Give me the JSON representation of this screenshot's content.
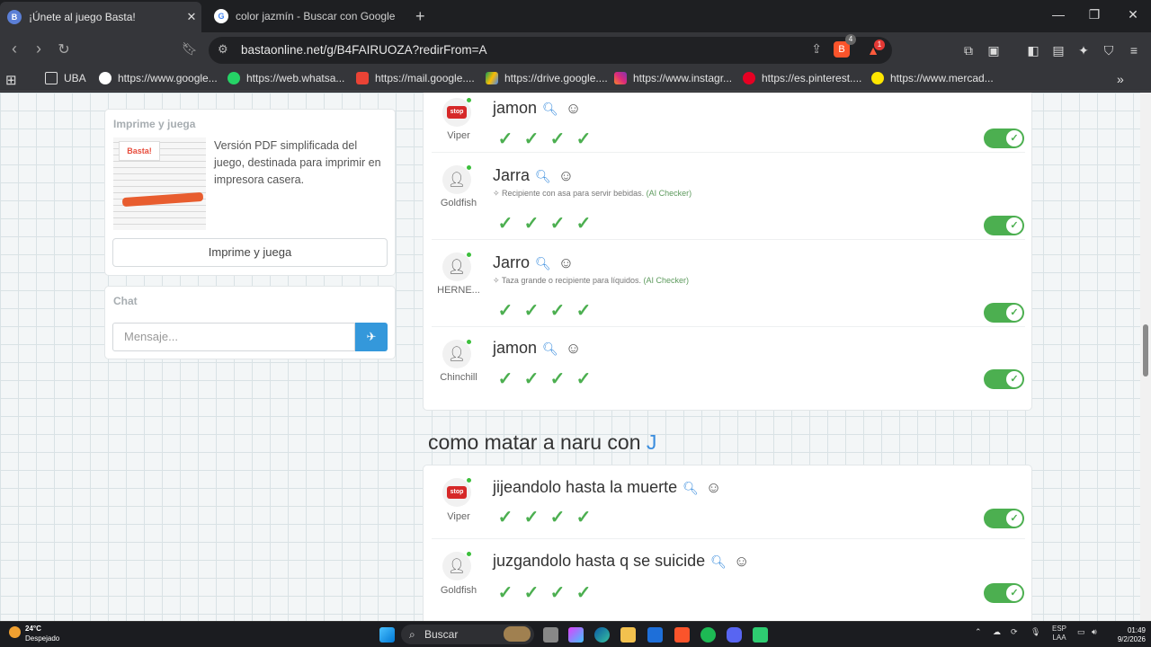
{
  "browser": {
    "tabs": [
      {
        "title": "¡Únete al juego Basta!",
        "active": true
      },
      {
        "title": "color jazmín - Buscar con Google",
        "active": false
      }
    ],
    "url": "bastaonline.net/g/B4FAIRUOZA?redirFrom=A",
    "extension_badges": {
      "brave": "4",
      "rewards": "1"
    },
    "bookmarks": [
      {
        "label": "UBA",
        "icon": "folder-icon"
      },
      {
        "label": "https://www.google...",
        "icon": "google-icon"
      },
      {
        "label": "https://web.whatsa...",
        "icon": "whatsapp-icon"
      },
      {
        "label": "https://mail.google....",
        "icon": "gmail-icon"
      },
      {
        "label": "https://drive.google....",
        "icon": "drive-icon"
      },
      {
        "label": "https://www.instagr...",
        "icon": "instagram-icon"
      },
      {
        "label": "https://es.pinterest....",
        "icon": "pinterest-icon"
      },
      {
        "label": "https://www.mercad...",
        "icon": "mercadolibre-icon"
      }
    ]
  },
  "sidebar": {
    "print_card": {
      "title": "Imprime y juega",
      "logo_text": "Basta!",
      "description": "Versión PDF simplificada del juego, destinada para imprimir en impresora casera.",
      "button_label": "Imprime y juega"
    },
    "chat": {
      "title": "Chat",
      "placeholder": "Mensaje..."
    }
  },
  "results": {
    "group_top": [
      {
        "user": "Viper",
        "avatar": "stop",
        "answer": "jamon",
        "ai_note": null,
        "checks": 4
      },
      {
        "user": "Goldfish",
        "avatar": "person",
        "answer": "Jarra",
        "ai_note": "Recipiente con asa para servir bebidas.",
        "ai_label": "(AI Checker)",
        "checks": 4
      },
      {
        "user": "HERNE...",
        "avatar": "person-star",
        "answer": "Jarro",
        "ai_note": "Taza grande o recipiente para líquidos.",
        "ai_label": "(AI Checker)",
        "checks": 4
      },
      {
        "user": "Chinchill",
        "avatar": "person",
        "answer": "jamon",
        "ai_note": null,
        "checks": 4
      }
    ],
    "category": {
      "title": "como matar a naru con",
      "letter": "J"
    },
    "group_bottom": [
      {
        "user": "Viper",
        "avatar": "stop",
        "answer": "jijeandolo hasta la muerte",
        "checks": 4
      },
      {
        "user": "Goldfish",
        "avatar": "person",
        "answer": "juzgandolo hasta q se suicide",
        "checks": 4
      }
    ]
  },
  "taskbar": {
    "weather_temp": "24°C",
    "weather_desc": "Despejado",
    "search_label": "Buscar",
    "lang": "ESP",
    "lang2": "LAA",
    "time": "01:49",
    "date": "9/2/2026"
  }
}
